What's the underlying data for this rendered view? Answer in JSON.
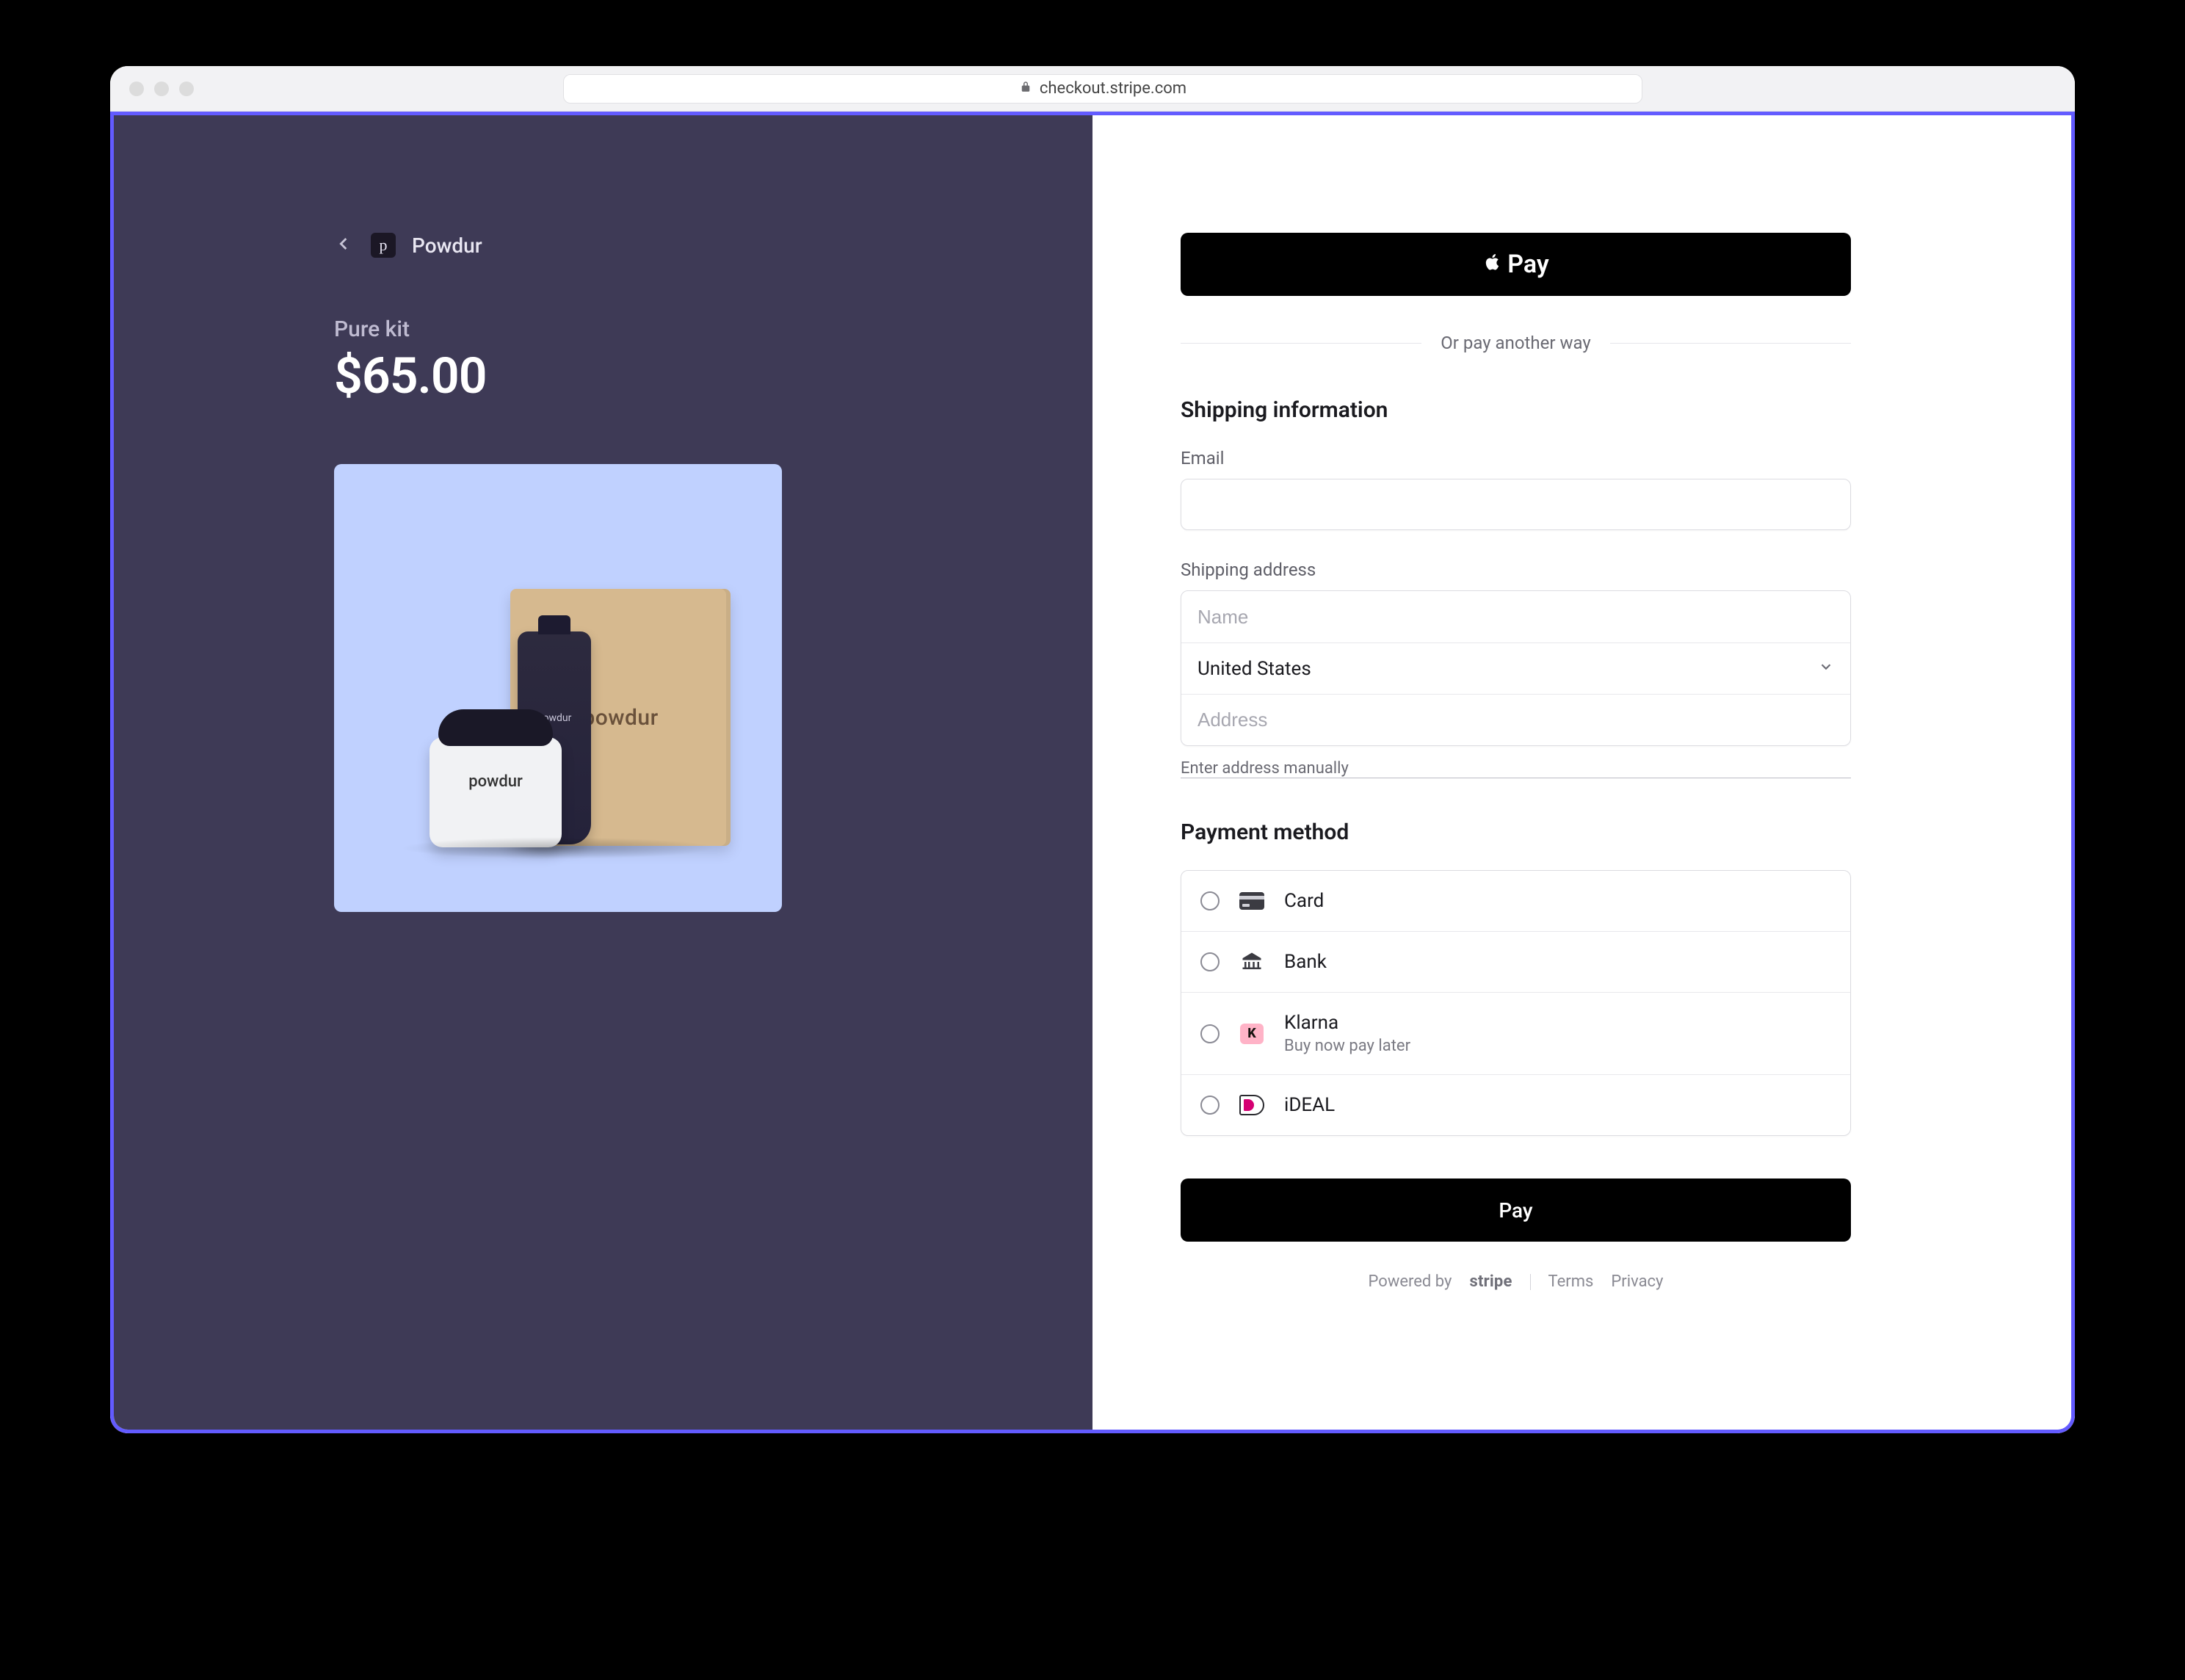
{
  "browser": {
    "url": "checkout.stripe.com"
  },
  "merchant": {
    "name": "Powdur",
    "logo_letter": "p"
  },
  "product": {
    "name": "Pure kit",
    "price": "$65.00",
    "box_label": "powdur",
    "tube_label": "powdur",
    "jar_label": "powdur"
  },
  "apple_pay_label": "Pay",
  "divider_text": "Or pay another way",
  "shipping": {
    "heading": "Shipping information",
    "email_label": "Email",
    "address_label": "Shipping address",
    "name_placeholder": "Name",
    "country_selected": "United States",
    "address_placeholder": "Address",
    "manual_link": "Enter address manually"
  },
  "payment": {
    "heading": "Payment method",
    "methods": [
      {
        "id": "card",
        "title": "Card",
        "sub": ""
      },
      {
        "id": "bank",
        "title": "Bank",
        "sub": ""
      },
      {
        "id": "klarna",
        "title": "Klarna",
        "sub": "Buy now pay later"
      },
      {
        "id": "ideal",
        "title": "iDEAL",
        "sub": ""
      }
    ]
  },
  "pay_button": "Pay",
  "footer": {
    "powered_by": "Powered by",
    "stripe": "stripe",
    "terms": "Terms",
    "privacy": "Privacy"
  }
}
